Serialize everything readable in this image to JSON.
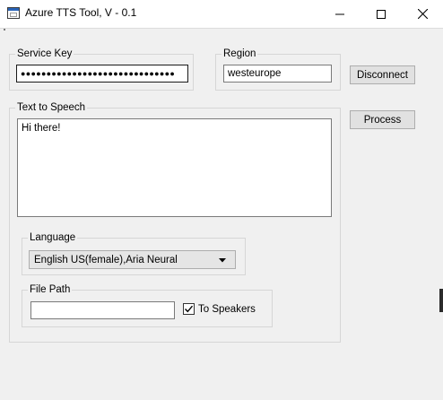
{
  "window": {
    "title": "Azure TTS Tool, V - 0.1",
    "icon": "app-window-icon",
    "controls": [
      "minimize-icon",
      "maximize-icon",
      "close-icon"
    ]
  },
  "service_key": {
    "label": "Service Key",
    "value": "●●●●●●●●●●●●●●●●●●●●●●●●●●●●●●"
  },
  "region": {
    "label": "Region",
    "value": "westeurope"
  },
  "buttons": {
    "disconnect": "Disconnect",
    "process": "Process"
  },
  "text_to_speech": {
    "label": "Text to Speech",
    "value": "Hi there!"
  },
  "language": {
    "label": "Language",
    "selected": "English US(female),Aria Neural"
  },
  "file_path": {
    "label": "File Path",
    "value": ""
  },
  "to_speakers": {
    "label": "To Speakers",
    "checked": true
  }
}
